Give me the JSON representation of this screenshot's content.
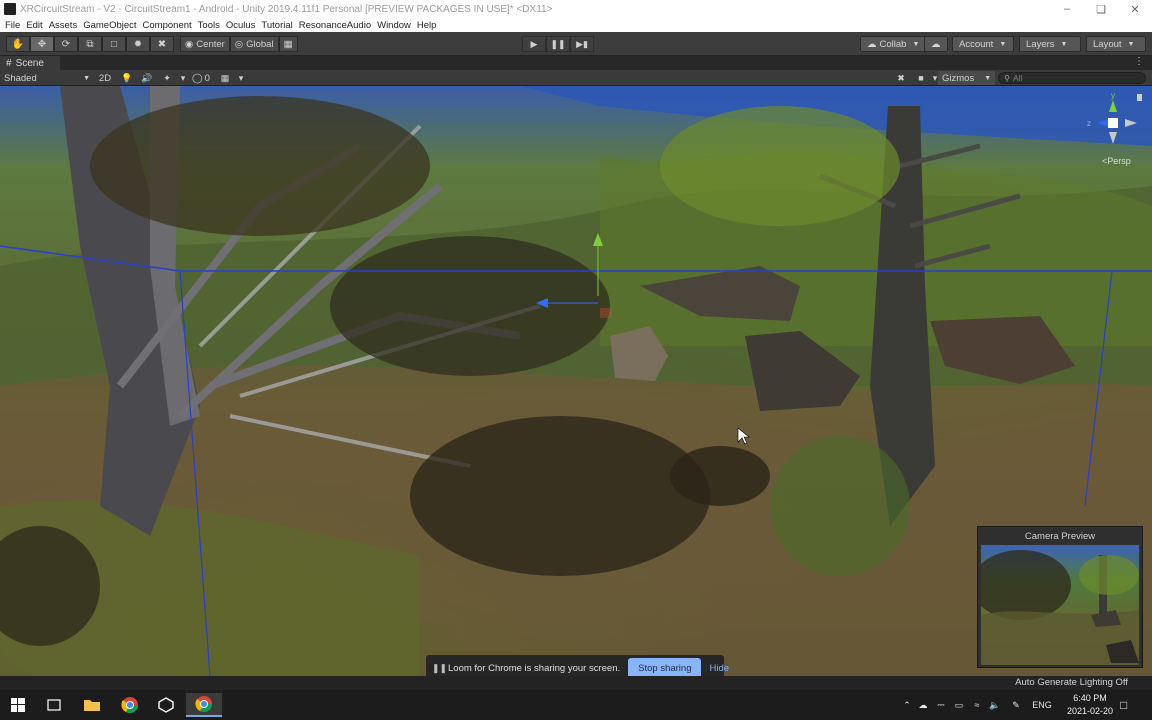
{
  "window": {
    "title": "XRCircuitStream - V2 - CircuitStream1 - Android - Unity 2019.4.11f1 Personal [PREVIEW PACKAGES IN USE]* <DX11>",
    "minimize_icon": "minimize-icon",
    "restore_icon": "restore-icon",
    "close_icon": "close-icon"
  },
  "menu": {
    "items": [
      "File",
      "Edit",
      "Assets",
      "GameObject",
      "Component",
      "Tools",
      "Oculus",
      "Tutorial",
      "ResonanceAudio",
      "Window",
      "Help"
    ]
  },
  "toolbar": {
    "tools": [
      {
        "icon": "hand-icon",
        "name": "hand-tool"
      },
      {
        "icon": "move-icon",
        "name": "move-tool",
        "active": true
      },
      {
        "icon": "rotate-icon",
        "name": "rotate-tool"
      },
      {
        "icon": "scale-icon",
        "name": "scale-tool"
      },
      {
        "icon": "rect-icon",
        "name": "rect-tool"
      },
      {
        "icon": "transform-icon",
        "name": "transform-tool"
      },
      {
        "icon": "custom-tool-icon",
        "name": "custom-tool"
      }
    ],
    "pivot_label": "Center",
    "space_label": "Global",
    "play_icon": "play-icon",
    "pause_icon": "pause-icon",
    "step_icon": "step-icon",
    "collab_label": "Collab",
    "cloud_icon": "cloud-icon",
    "account_label": "Account",
    "layers_label": "Layers",
    "layout_label": "Layout"
  },
  "scene_panel": {
    "tab_label": "Scene",
    "draw_mode": "Shaded",
    "mode_2d": "2D",
    "hidden_count": "0",
    "gizmos_label": "Gizmos",
    "search_placeholder": "All",
    "persp_label": "<Persp",
    "gizmo_axes": {
      "y": "y",
      "z": "z"
    }
  },
  "camera_preview": {
    "title": "Camera Preview"
  },
  "loom": {
    "message": "Loom for Chrome is sharing your screen.",
    "stop_label": "Stop sharing",
    "hide_label": "Hide"
  },
  "status": {
    "text": "Auto Generate Lighting Off"
  },
  "taskbar": {
    "apps": [
      "windows-start-icon",
      "task-view-icon",
      "file-explorer-icon",
      "chrome-icon",
      "unity-icon",
      "chrome-active-icon"
    ],
    "language": "ENG",
    "time": "6:40 PM",
    "date": "2021-02-20"
  },
  "colors": {
    "editor_bg": "#3c3c3c",
    "accent_blue": "#8ab4f8",
    "gizmo_green": "#7bd13b",
    "gizmo_blue": "#2f6cf0",
    "gizmo_red": "#d9483b"
  }
}
